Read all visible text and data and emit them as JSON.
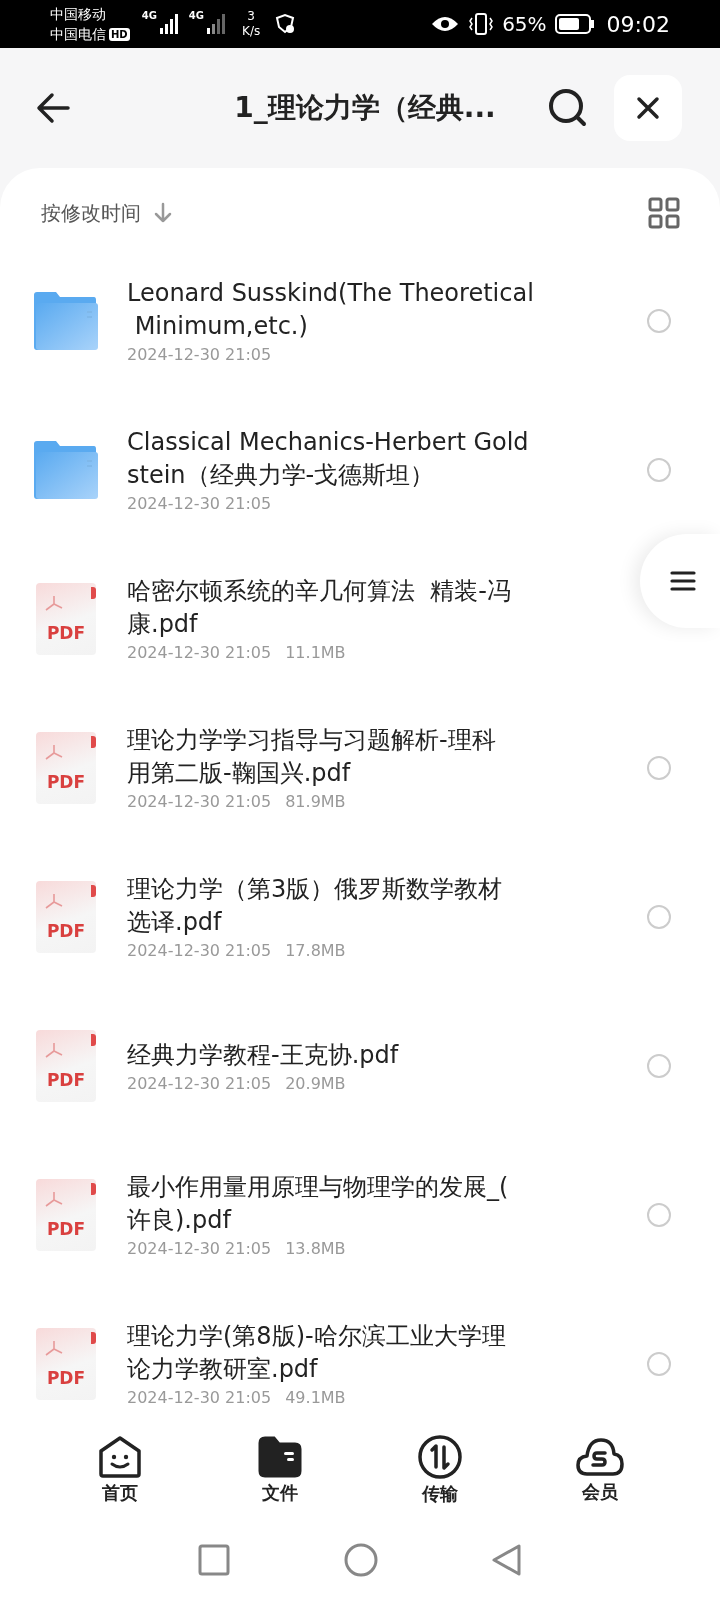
{
  "status_bar": {
    "carrier_1": "中国移动",
    "carrier_2": "中国电信",
    "hd": "HD",
    "net_1": "4G",
    "net_2": "4G",
    "speed_value": "3",
    "speed_unit": "K/s",
    "battery": "65%",
    "time": "09:02"
  },
  "header": {
    "title": "1_理论力学（经典..."
  },
  "sort": {
    "label": "按修改时间"
  },
  "files": [
    {
      "kind": "folder",
      "title_lines": [
        "Leonard Susskind(The Theoretical",
        " Minimum,etc.)"
      ],
      "date": "2024-12-30 21:05",
      "selected": false
    },
    {
      "kind": "folder",
      "title_lines": [
        "Classical Mechanics-Herbert Gold",
        "stein（经典力学-戈德斯坦）"
      ],
      "date": "2024-12-30 21:05",
      "selected": false
    },
    {
      "kind": "pdf",
      "title_lines": [
        "哈密尔顿系统的辛几何算法  精装-冯",
        "康.pdf"
      ],
      "date": "2024-12-30 21:05",
      "size": "11.1MB",
      "icon_label": "PDF"
    },
    {
      "kind": "pdf",
      "title_lines": [
        "理论力学学习指导与习题解析-理科",
        "用第二版-鞠国兴.pdf"
      ],
      "date": "2024-12-30 21:05",
      "size": "81.9MB",
      "icon_label": "PDF",
      "selected": false
    },
    {
      "kind": "pdf",
      "title_lines": [
        "理论力学（第3版）俄罗斯数学教材",
        "选译.pdf"
      ],
      "date": "2024-12-30 21:05",
      "size": "17.8MB",
      "icon_label": "PDF",
      "selected": false
    },
    {
      "kind": "pdf",
      "title_lines": [
        "经典力学教程-王克协.pdf"
      ],
      "date": "2024-12-30 21:05",
      "size": "20.9MB",
      "icon_label": "PDF",
      "selected": false
    },
    {
      "kind": "pdf",
      "title_lines": [
        "最小作用量用原理与物理学的发展_(",
        "许良).pdf"
      ],
      "date": "2024-12-30 21:05",
      "size": "13.8MB",
      "icon_label": "PDF",
      "selected": false
    },
    {
      "kind": "pdf",
      "title_lines": [
        "理论力学(第8版)-哈尔滨工业大学理",
        "论力学教研室.pdf"
      ],
      "date": "2024-12-30 21:05",
      "size": "49.1MB",
      "icon_label": "PDF",
      "selected": false
    }
  ],
  "bottom_nav": [
    {
      "kind": "home",
      "label": "首页",
      "selected": false
    },
    {
      "kind": "files",
      "label": "文件",
      "selected": true
    },
    {
      "kind": "transfer",
      "label": "传输",
      "selected": false
    },
    {
      "kind": "vip",
      "label": "会员",
      "selected": false
    }
  ]
}
